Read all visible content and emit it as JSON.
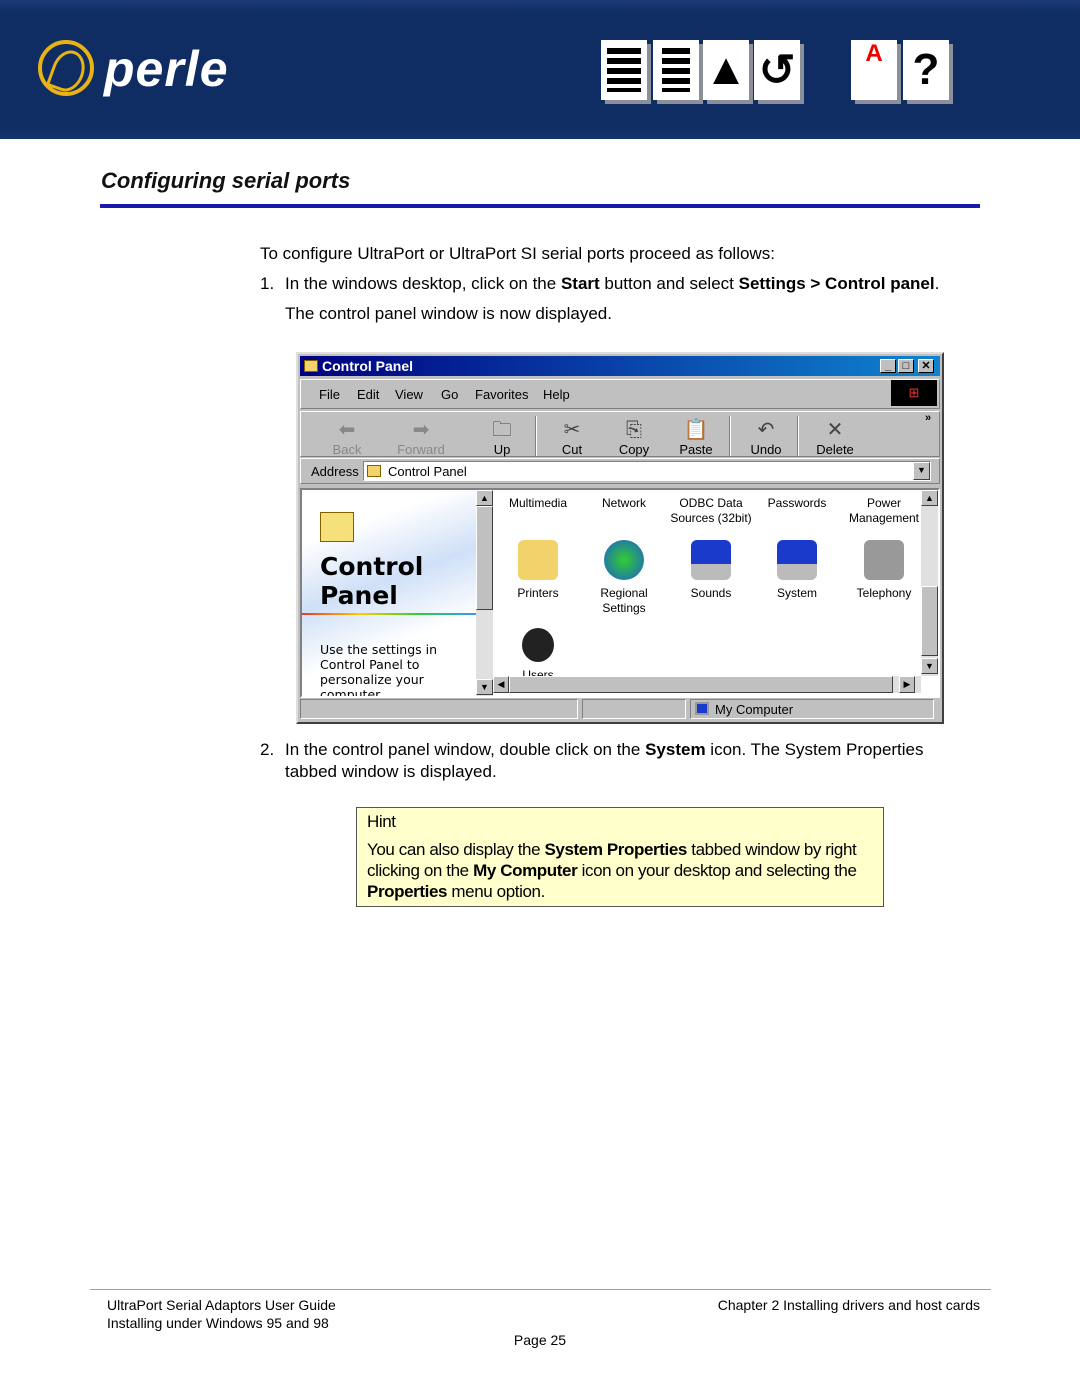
{
  "header": {
    "logo_text": "perle",
    "nav_icons": [
      "contents-icon",
      "index-icon",
      "top-icon",
      "back-icon",
      "glossary-icon",
      "help-icon"
    ],
    "brand_color": "#0f2c63"
  },
  "section_title": "Configuring serial ports",
  "intro": "To configure UltraPort or UltraPort SI serial ports proceed as follows:",
  "step1": {
    "num": "1.",
    "t1": "In the windows desktop, click on the ",
    "b1": "Start",
    "t2": " button and select ",
    "b2": "Settings > Control panel",
    "t3": ".",
    "line2": "The control panel window is now displayed."
  },
  "window": {
    "title": "Control Panel",
    "menu": [
      "File",
      "Edit",
      "View",
      "Go",
      "Favorites",
      "Help"
    ],
    "toolbar": [
      "Back",
      "Forward",
      "Up",
      "Cut",
      "Copy",
      "Paste",
      "Undo",
      "Delete"
    ],
    "address_label": "Address",
    "address_value": "Control Panel",
    "panel_title1": "Control",
    "panel_title2": "Panel",
    "panel_desc": "Use the settings in Control Panel to personalize your computer.",
    "top_items": [
      "Multimedia",
      "Network",
      "ODBC Data Sources (32bit)",
      "Passwords",
      "Power Management"
    ],
    "items": [
      "Printers",
      "Regional Settings",
      "Sounds",
      "System",
      "Telephony"
    ],
    "partial_item": "Users",
    "status": "My Computer"
  },
  "step2": {
    "num": "2.",
    "t1": "In the control panel window, double click on the ",
    "b1": "System",
    "t2": " icon. The System Properties",
    "line2": "tabbed window is displayed."
  },
  "hint": {
    "title": "Hint",
    "t1": "You can also display the ",
    "b1": "System Properties",
    "t2": " tabbed window by right clicking on the ",
    "b2": "My Computer",
    "t3": " icon on your desktop and selecting the ",
    "b3": "Properties",
    "t4": " menu option."
  },
  "footer": {
    "left1": "UltraPort Serial Adaptors User Guide",
    "left2": "Installing under Windows 95 and 98",
    "right": "Chapter 2 Installing drivers and host cards",
    "page": "Page 25"
  }
}
